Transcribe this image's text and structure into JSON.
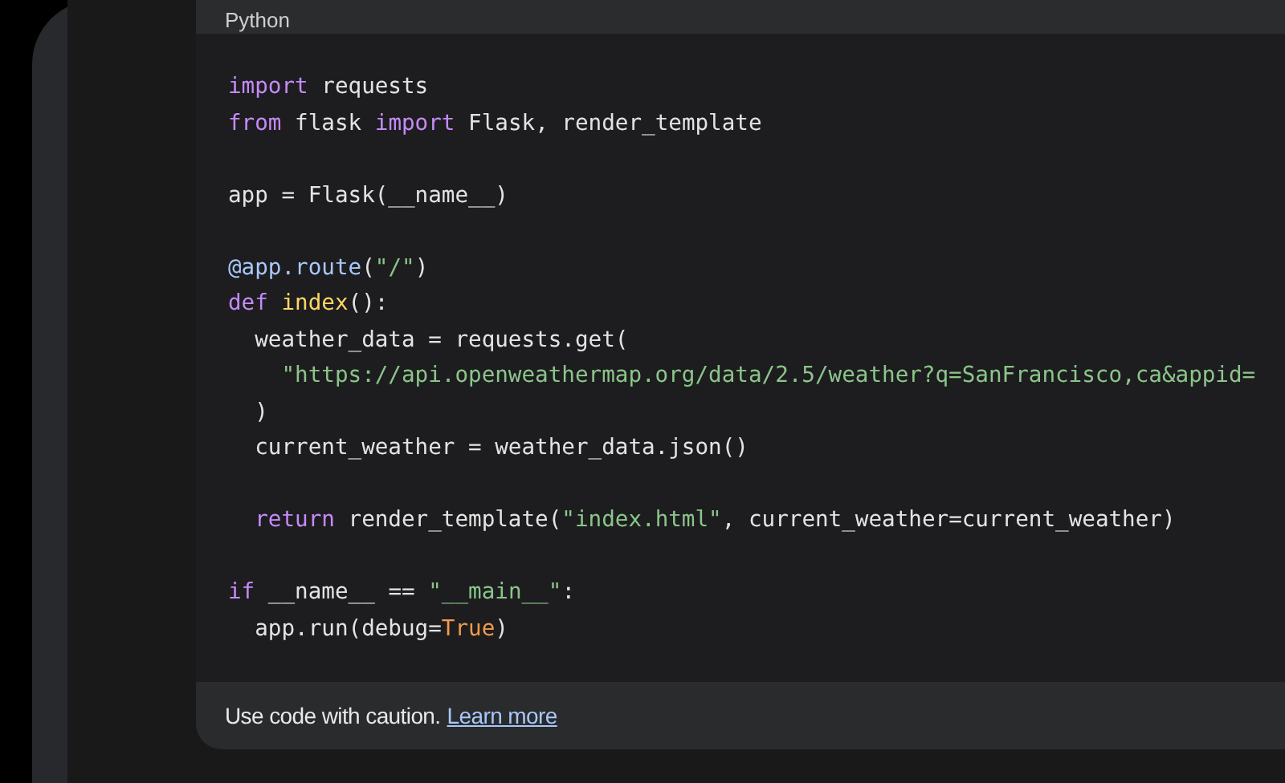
{
  "code_block": {
    "language": "Python",
    "lines": [
      {
        "kind": "code",
        "tokens": [
          {
            "kind": "keyword",
            "text": "import"
          },
          {
            "kind": "plain",
            "text": " requests"
          }
        ]
      },
      {
        "kind": "code",
        "tokens": [
          {
            "kind": "keyword",
            "text": "from"
          },
          {
            "kind": "plain",
            "text": " flask "
          },
          {
            "kind": "keyword",
            "text": "import"
          },
          {
            "kind": "plain",
            "text": " Flask, render_template"
          }
        ]
      },
      {
        "kind": "blank"
      },
      {
        "kind": "code",
        "tokens": [
          {
            "kind": "plain",
            "text": "app = Flask(__name__)"
          }
        ]
      },
      {
        "kind": "blank"
      },
      {
        "kind": "code",
        "tokens": [
          {
            "kind": "decorator",
            "text": "@app.route"
          },
          {
            "kind": "plain",
            "text": "("
          },
          {
            "kind": "string",
            "text": "\"/\""
          },
          {
            "kind": "plain",
            "text": ")"
          }
        ]
      },
      {
        "kind": "code",
        "tokens": [
          {
            "kind": "keyword",
            "text": "def"
          },
          {
            "kind": "function",
            "text": " index"
          },
          {
            "kind": "plain",
            "text": "():"
          }
        ]
      },
      {
        "kind": "code",
        "tokens": [
          {
            "kind": "plain",
            "text": "  weather_data = requests.get("
          }
        ]
      },
      {
        "kind": "code",
        "tokens": [
          {
            "kind": "string",
            "text": "    \"https://api.openweathermap.org/data/2.5/weather?q=SanFrancisco,ca&appid="
          }
        ]
      },
      {
        "kind": "code",
        "tokens": [
          {
            "kind": "plain",
            "text": "  )"
          }
        ]
      },
      {
        "kind": "code",
        "tokens": [
          {
            "kind": "plain",
            "text": "  current_weather = weather_data.json()"
          }
        ]
      },
      {
        "kind": "blank"
      },
      {
        "kind": "code",
        "tokens": [
          {
            "kind": "keyword",
            "text": "  return"
          },
          {
            "kind": "plain",
            "text": " render_template("
          },
          {
            "kind": "string",
            "text": "\"index.html\""
          },
          {
            "kind": "plain",
            "text": ", current_weather=current_weather)"
          }
        ]
      },
      {
        "kind": "blank"
      },
      {
        "kind": "code",
        "tokens": [
          {
            "kind": "keyword",
            "text": "if"
          },
          {
            "kind": "plain",
            "text": " __name__ == "
          },
          {
            "kind": "string",
            "text": "\"__main__\""
          },
          {
            "kind": "plain",
            "text": ":"
          }
        ]
      },
      {
        "kind": "code",
        "tokens": [
          {
            "kind": "plain",
            "text": "  app.run(debug="
          },
          {
            "kind": "constant",
            "text": "True"
          },
          {
            "kind": "plain",
            "text": ")"
          }
        ]
      }
    ]
  },
  "footer": {
    "note": "Use code with caution.",
    "link": "Learn more"
  }
}
